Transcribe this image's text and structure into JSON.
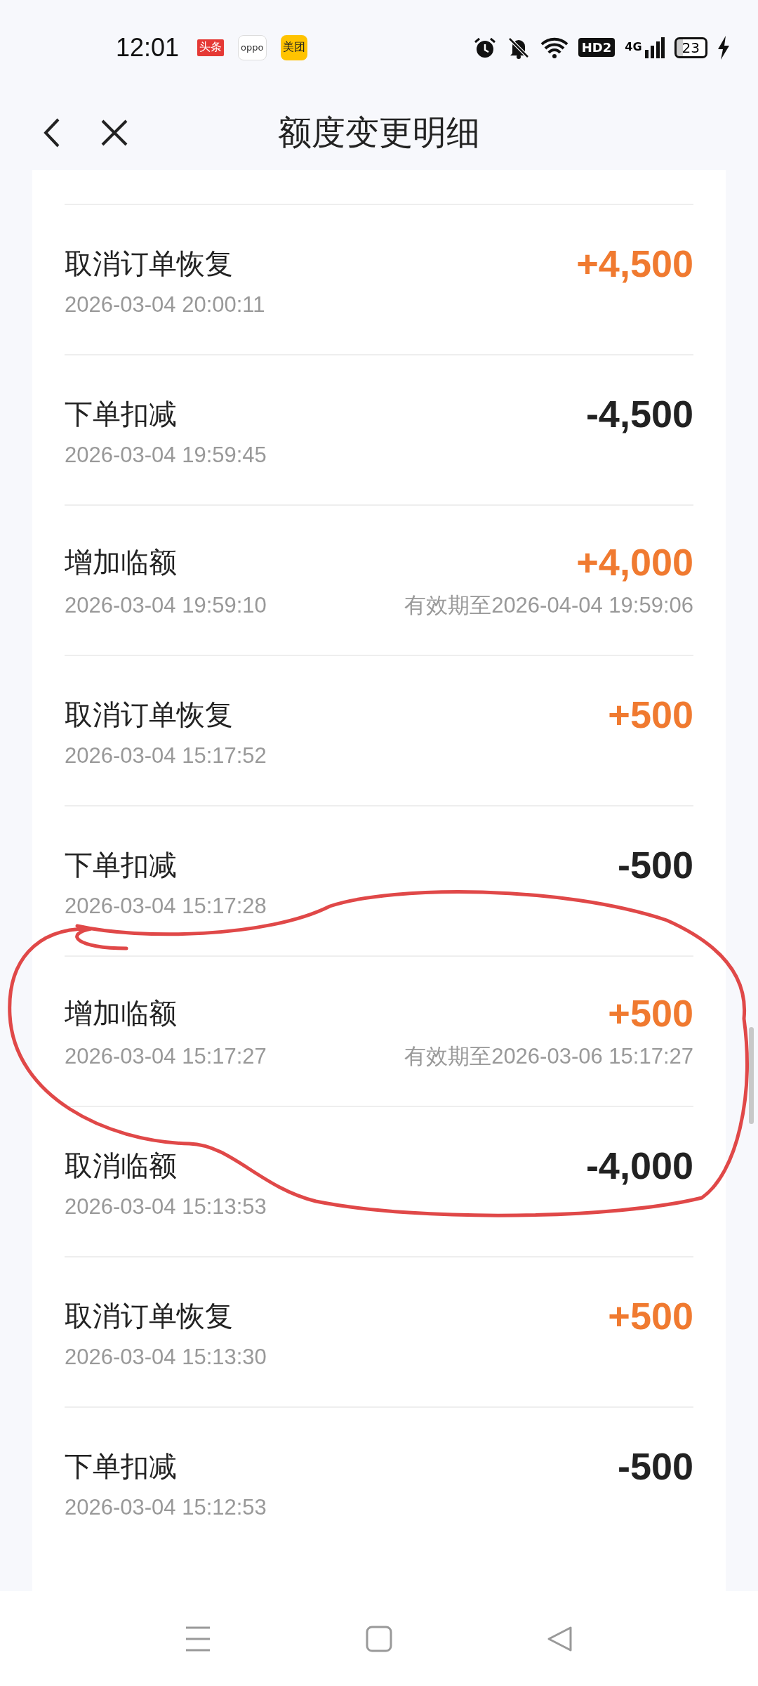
{
  "status_bar": {
    "time": "12:01",
    "app_icons": [
      {
        "label": "头条",
        "kind": "toutiao"
      },
      {
        "label": "oppo",
        "kind": "oppo"
      },
      {
        "label": "美团",
        "kind": "meituan"
      }
    ],
    "hd": "HD2",
    "network": "4G",
    "battery": "23"
  },
  "header": {
    "title": "额度变更明细"
  },
  "records": [
    {
      "title": "取消订单恢复",
      "time": "2026-03-04 20:00:11",
      "amount": "+4,500",
      "kind": "credit"
    },
    {
      "title": "下单扣减",
      "time": "2026-03-04 19:59:45",
      "amount": "-4,500",
      "kind": "debit"
    },
    {
      "title": "增加临额",
      "time": "2026-03-04 19:59:10",
      "amount": "+4,000",
      "kind": "credit",
      "validity": "有效期至2026-04-04 19:59:06"
    },
    {
      "title": "取消订单恢复",
      "time": "2026-03-04 15:17:52",
      "amount": "+500",
      "kind": "credit"
    },
    {
      "title": "下单扣减",
      "time": "2026-03-04 15:17:28",
      "amount": "-500",
      "kind": "debit"
    },
    {
      "title": "增加临额",
      "time": "2026-03-04 15:17:27",
      "amount": "+500",
      "kind": "credit",
      "validity": "有效期至2026-03-06 15:17:27"
    },
    {
      "title": "取消临额",
      "time": "2026-03-04 15:13:53",
      "amount": "-4,000",
      "kind": "debit"
    },
    {
      "title": "取消订单恢复",
      "time": "2026-03-04 15:13:30",
      "amount": "+500",
      "kind": "credit"
    },
    {
      "title": "下单扣减",
      "time": "2026-03-04 15:12:53",
      "amount": "-500",
      "kind": "debit"
    }
  ]
}
